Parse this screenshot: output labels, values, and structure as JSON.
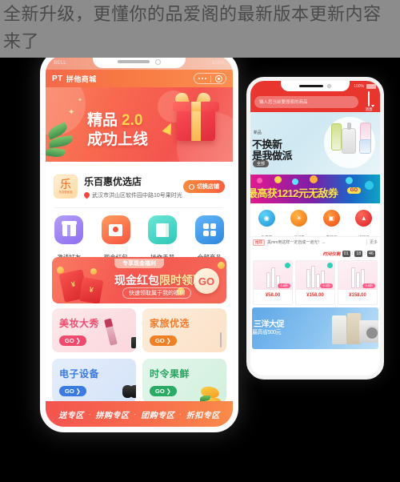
{
  "article": {
    "title": "全新升级，更懂你的品爱阁的最新版本更新内容来了"
  },
  "left_phone": {
    "status": {
      "carrier": "BELL",
      "battery": "100%"
    },
    "appbar": {
      "logo": "PT",
      "name": "拼他商城"
    },
    "hero_banner": {
      "line1": "精品",
      "version": "2.0",
      "line2": "成功上线"
    },
    "store": {
      "logo_glyph": "乐",
      "logo_caption": "乐百惠优选",
      "name": "乐百惠优选店",
      "address": "武汉市洪山区软件园中路10号果时光",
      "switch_label": "切换店铺"
    },
    "entries": [
      {
        "label": "邀请好友",
        "icon": "gift-icon"
      },
      {
        "label": "现金红包",
        "icon": "red-envelope-icon"
      },
      {
        "label": "操作手册",
        "icon": "book-icon"
      },
      {
        "label": "全部商品",
        "icon": "grid-icon"
      }
    ],
    "promo": {
      "tag": "专享现金福利",
      "title_a": "现金红包",
      "title_b": "限时领取",
      "subtitle": "快速领取属于我的福利",
      "go_label": "GO"
    },
    "categories": [
      {
        "title": "美妆大秀",
        "go": "GO",
        "art": "lipstick"
      },
      {
        "title": "家旅优选",
        "go": "GO",
        "art": "suitcase"
      },
      {
        "title": "电子设备",
        "go": "GO",
        "art": "headphone"
      },
      {
        "title": "时令果鲜",
        "go": "GO",
        "art": "mango"
      }
    ],
    "zones": [
      "送专区",
      "拼购专区",
      "团购专区",
      "折扣专区"
    ],
    "zone_separator": "·"
  },
  "right_phone": {
    "status": {
      "battery": "100%"
    },
    "search": {
      "placeholder": "输入您当前要搜索的商品"
    },
    "message": {
      "label": "消息"
    },
    "hero": {
      "tag": "新品",
      "line1": "不换新",
      "line2": "是我做派",
      "button": "全部"
    },
    "coupon": {
      "text": "最高获1212元无敌券",
      "go": "GO"
    },
    "quick_entries": [
      {
        "label": "推广赚",
        "icon": "broadcast-icon"
      },
      {
        "label": "寻好货",
        "icon": "bulb-icon"
      },
      {
        "label": "参团买",
        "icon": "basket-icon"
      },
      {
        "label": "拼团买",
        "icon": "fire-icon"
      }
    ],
    "recommend": {
      "badge": "推荐",
      "text": "黑mm用这样一定自成一道光！...",
      "more": "更多"
    },
    "countdown": {
      "label": "时间仅剩",
      "hours": "01",
      "minutes": "18",
      "seconds": "46",
      "separator": ":"
    },
    "products": [
      {
        "price": "¥58.00",
        "discount": "9.8折"
      },
      {
        "price": "¥158.00",
        "discount": "9.8折"
      },
      {
        "price": "¥158.00",
        "discount": "9.8折"
      }
    ],
    "bottom_promo": {
      "title": "三洋大促",
      "subtitle": "最高省500元"
    }
  },
  "colors": {
    "page_bg": "#000000",
    "header_bg": "#8c8c8c",
    "brand_orange": "#f76a4c",
    "brand_red": "#e8352e",
    "accent_gold": "#ffd74e"
  }
}
